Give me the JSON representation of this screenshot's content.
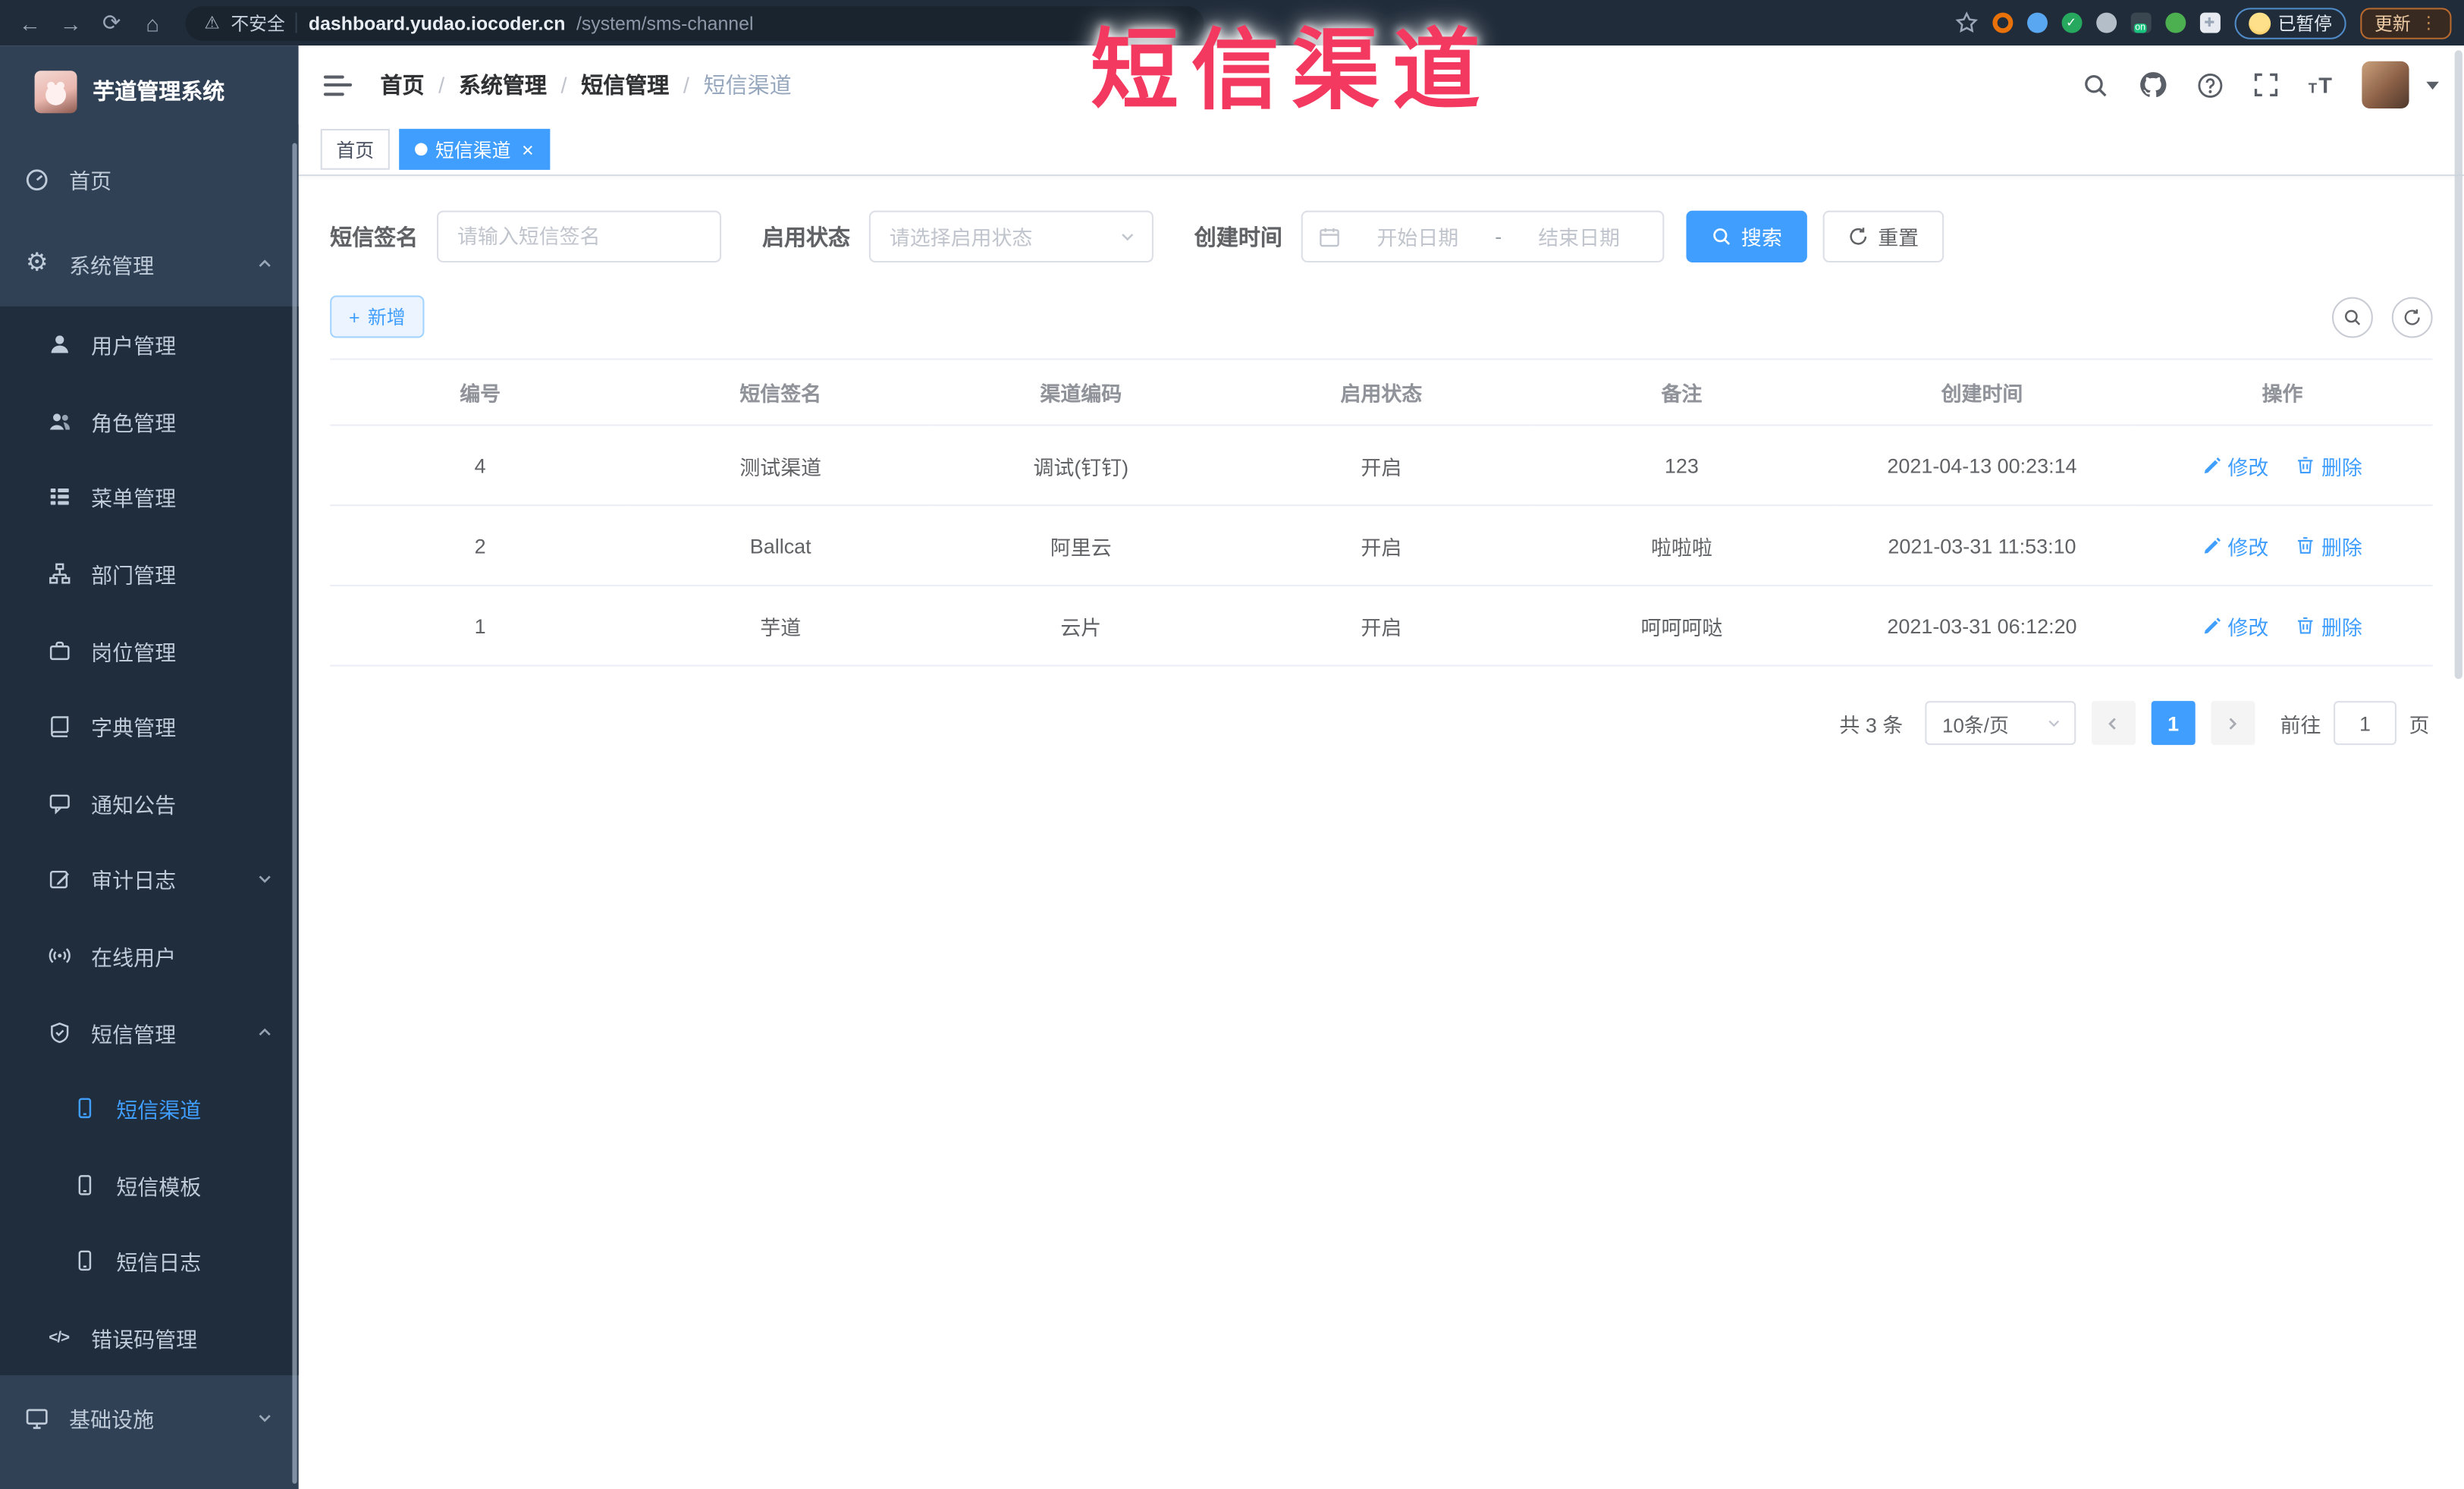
{
  "colors": {
    "accent": "#409EFF",
    "overlay_title": "#f3395f",
    "sidebar_bg": "#304156",
    "sidebar_submenu_bg": "#1f2d3d",
    "tab_active_bg": "#409EFF"
  },
  "overlay": {
    "title": "短信渠道"
  },
  "browser": {
    "security_label": "不安全",
    "url_host": "dashboard.yudao.iocoder.cn",
    "url_path": "/system/sms-channel",
    "paused_label": "已暂停",
    "update_label": "更新",
    "kebab": "⋮",
    "nav_icons": [
      "back-icon",
      "forward-icon",
      "reload-icon",
      "home-icon"
    ],
    "extension_icons": [
      "bookmark-star-icon",
      "orange-extension-icon",
      "blue-extension-icon",
      "green-check-extension-icon",
      "people-extension-icon",
      "on-badge-extension-icon",
      "plant-extension-icon",
      "puzzle-extensions-icon"
    ]
  },
  "sidebar": {
    "app_title": "芋道管理系统",
    "items": [
      {
        "label": "首页",
        "icon": "dashboard-icon",
        "level": 1
      },
      {
        "label": "系统管理",
        "icon": "gear-icon",
        "level": 1,
        "arrow": "up",
        "arrow_glyph": "⌃"
      },
      {
        "label": "用户管理",
        "icon": "user-icon",
        "level": 2
      },
      {
        "label": "角色管理",
        "icon": "users-icon",
        "level": 2
      },
      {
        "label": "菜单管理",
        "icon": "menu-list-icon",
        "level": 2
      },
      {
        "label": "部门管理",
        "icon": "org-tree-icon",
        "level": 2
      },
      {
        "label": "岗位管理",
        "icon": "briefcase-icon",
        "level": 2
      },
      {
        "label": "字典管理",
        "icon": "dictionary-icon",
        "level": 2
      },
      {
        "label": "通知公告",
        "icon": "announcement-icon",
        "level": 2
      },
      {
        "label": "审计日志",
        "icon": "audit-log-icon",
        "level": 2,
        "arrow": "down",
        "arrow_glyph": "⌄"
      },
      {
        "label": "在线用户",
        "icon": "online-users-icon",
        "level": 2
      },
      {
        "label": "短信管理",
        "icon": "sms-shield-icon",
        "level": 2,
        "arrow": "up",
        "arrow_glyph": "⌃"
      },
      {
        "label": "短信渠道",
        "icon": "phone-icon",
        "level": 3,
        "active": true
      },
      {
        "label": "短信模板",
        "icon": "phone-icon",
        "level": 3
      },
      {
        "label": "短信日志",
        "icon": "phone-icon",
        "level": 3
      },
      {
        "label": "错误码管理",
        "icon": "code-icon",
        "level": 2
      },
      {
        "label": "基础设施",
        "icon": "monitor-icon",
        "level": 1,
        "arrow": "down",
        "arrow_glyph": "⌄"
      }
    ]
  },
  "header": {
    "breadcrumbs": [
      {
        "label": "首页"
      },
      {
        "label": "系统管理"
      },
      {
        "label": "短信管理"
      },
      {
        "label": "短信渠道"
      }
    ],
    "separator": "/",
    "icons": [
      "search-icon",
      "github-icon",
      "question-icon",
      "fullscreen-icon",
      "font-size-icon",
      "avatar",
      "caret-down-icon"
    ]
  },
  "tabs": [
    {
      "label": "首页",
      "active": false
    },
    {
      "label": "短信渠道",
      "active": true,
      "close": "×"
    }
  ],
  "filters": {
    "sign_label": "短信签名",
    "sign_placeholder": "请输入短信签名",
    "status_label": "启用状态",
    "status_placeholder": "请选择启用状态",
    "time_label": "创建时间",
    "start_placeholder": "开始日期",
    "range_separator": "-",
    "end_placeholder": "结束日期",
    "search_label": "搜索",
    "reset_label": "重置"
  },
  "toolbar": {
    "add_label": "新增",
    "plus": "+",
    "icons": [
      "search-toggle-icon",
      "refresh-icon"
    ]
  },
  "table": {
    "headers": [
      "编号",
      "短信签名",
      "渠道编码",
      "启用状态",
      "备注",
      "创建时间",
      "操作"
    ],
    "rows": [
      {
        "id": "4",
        "sign": "测试渠道",
        "code": "调试(钉钉)",
        "status": "开启",
        "remark": "123",
        "created": "2021-04-13 00:23:14"
      },
      {
        "id": "2",
        "sign": "Ballcat",
        "code": "阿里云",
        "status": "开启",
        "remark": "啦啦啦",
        "created": "2021-03-31 11:53:10"
      },
      {
        "id": "1",
        "sign": "芋道",
        "code": "云片",
        "status": "开启",
        "remark": "呵呵呵哒",
        "created": "2021-03-31 06:12:20"
      }
    ],
    "edit_label": "修改",
    "delete_label": "删除"
  },
  "pagination": {
    "total_label": "共 3 条",
    "page_size": "10条/页",
    "current_page": "1",
    "goto_label": "前往",
    "goto_value": "1",
    "page_suffix": "页"
  }
}
